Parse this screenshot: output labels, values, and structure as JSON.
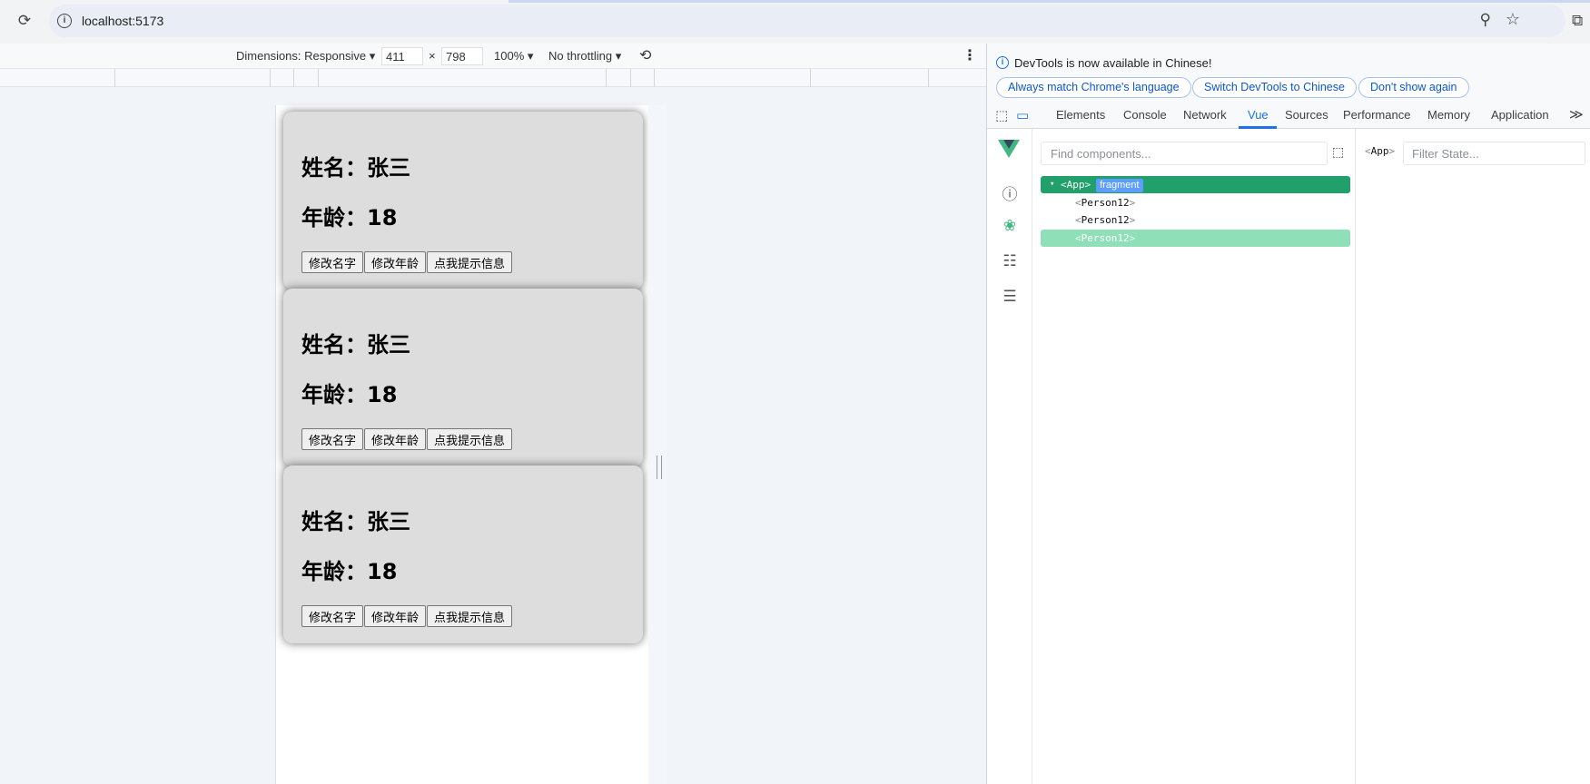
{
  "browser": {
    "url": "localhost:5173"
  },
  "device_toolbar": {
    "dimensions_label": "Dimensions: Responsive",
    "width": "411",
    "times": "×",
    "height": "798",
    "zoom": "100%",
    "throttling": "No throttling"
  },
  "app": {
    "cards": [
      {
        "name_line": "姓名：张三",
        "age_line": "年龄：18",
        "buttons": [
          "修改名字",
          "修改年龄",
          "点我提示信息"
        ]
      },
      {
        "name_line": "姓名：张三",
        "age_line": "年龄：18",
        "buttons": [
          "修改名字",
          "修改年龄",
          "点我提示信息"
        ]
      },
      {
        "name_line": "姓名：张三",
        "age_line": "年龄：18",
        "buttons": [
          "修改名字",
          "修改年龄",
          "点我提示信息"
        ]
      }
    ]
  },
  "devtools": {
    "banner": {
      "message": "DevTools is now available in Chinese!",
      "btn_match": "Always match Chrome's language",
      "btn_switch": "Switch DevTools to Chinese",
      "btn_dismiss": "Don't show again"
    },
    "tabs": [
      "Elements",
      "Console",
      "Network",
      "Vue",
      "Sources",
      "Performance",
      "Memory",
      "Application"
    ],
    "more_tabs": "≫",
    "vue": {
      "find_placeholder": "Find components...",
      "filter_placeholder": "Filter State...",
      "selected_component": "App",
      "tree": {
        "root": "App",
        "root_badge": "fragment",
        "children": [
          "Person12",
          "Person12",
          "Person12"
        ]
      }
    }
  }
}
